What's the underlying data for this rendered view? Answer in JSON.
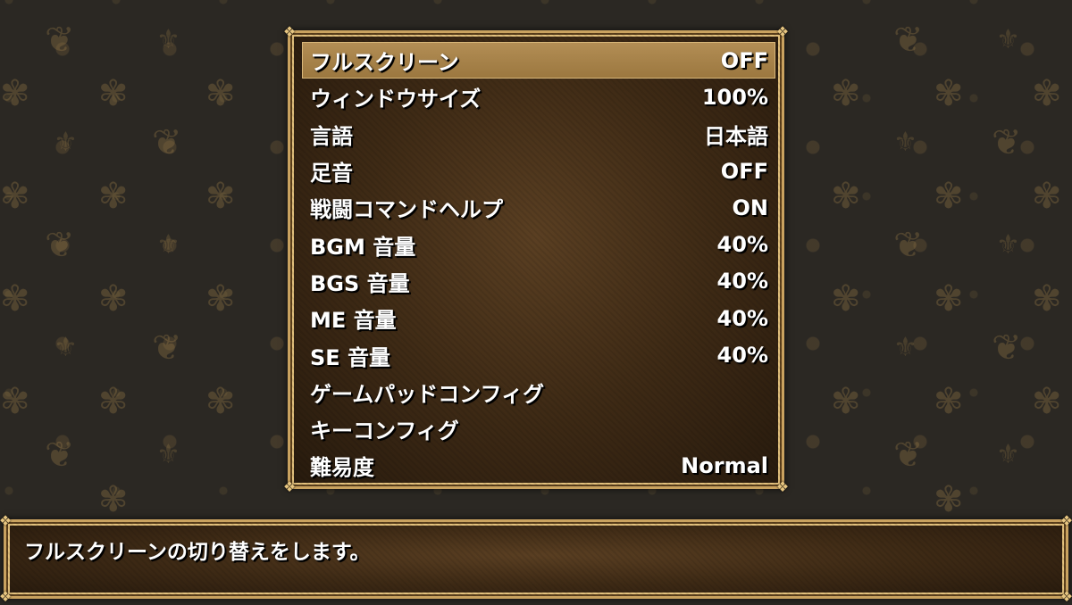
{
  "options": [
    {
      "label": "フルスクリーン",
      "value": "OFF",
      "selected": true
    },
    {
      "label": "ウィンドウサイズ",
      "value": "100%"
    },
    {
      "label": "言語",
      "value": "日本語"
    },
    {
      "label": "足音",
      "value": "OFF"
    },
    {
      "label": "戦闘コマンドヘルプ",
      "value": "ON"
    },
    {
      "label": "BGM 音量",
      "value": "40%"
    },
    {
      "label": "BGS 音量",
      "value": "40%"
    },
    {
      "label": "ME 音量",
      "value": "40%"
    },
    {
      "label": "SE 音量",
      "value": "40%"
    },
    {
      "label": "ゲームパッドコンフィグ",
      "value": ""
    },
    {
      "label": "キーコンフィグ",
      "value": ""
    },
    {
      "label": "難易度",
      "value": "Normal"
    }
  ],
  "help": {
    "text": "フルスクリーンの切り替えをします。"
  },
  "colors": {
    "highlight": "#a8834a",
    "frame": "#c9a25f",
    "text": "#ffffff"
  },
  "icons": {
    "corner": "ornament-corner-icon",
    "pattern": "damask-pattern"
  }
}
